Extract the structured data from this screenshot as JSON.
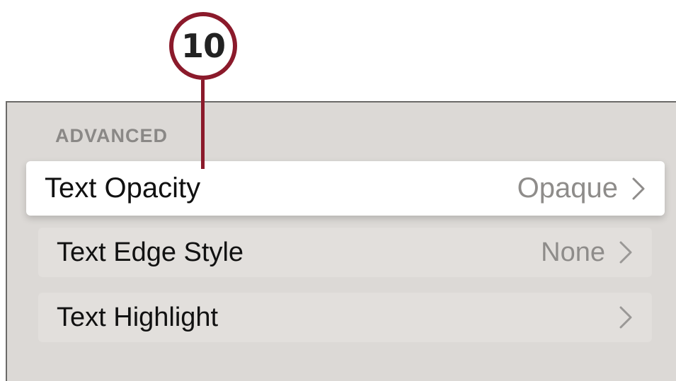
{
  "callout": {
    "number": "10",
    "color": "#8b1a2b"
  },
  "section": {
    "header": "ADVANCED"
  },
  "rows": [
    {
      "label": "Text Opacity",
      "value": "Opaque",
      "focused": true,
      "icon": "chevron-right-icon"
    },
    {
      "label": "Text Edge Style",
      "value": "None",
      "focused": false,
      "icon": "chevron-right-icon"
    },
    {
      "label": "Text Highlight",
      "value": "",
      "focused": false,
      "icon": "chevron-right-icon"
    }
  ]
}
